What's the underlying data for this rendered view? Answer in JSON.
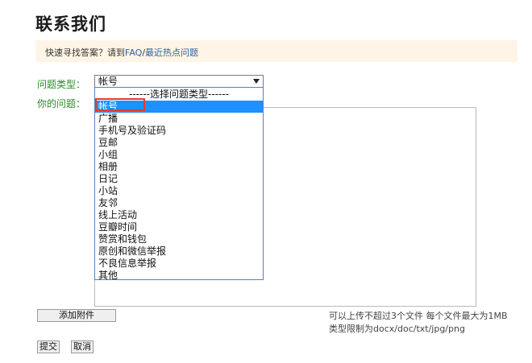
{
  "page": {
    "title": "联系我们"
  },
  "tip": {
    "prefix": "快速寻找答案？请到",
    "link1": "FAQ",
    "separator": "/",
    "link2": "最近热点问题"
  },
  "form": {
    "type_label": "问题类型：",
    "question_label": "你的问题：",
    "select_value": "帐号",
    "options": [
      "------选择问题类型------",
      "帐号",
      "广播",
      "手机号及验证码",
      "豆邮",
      "小组",
      "相册",
      "日记",
      "小站",
      "友邻",
      "线上活动",
      "豆瓣时间",
      "赞赏和钱包",
      "原创和微信举报",
      "不良信息举报",
      "其他"
    ],
    "selected_index": 1,
    "attach_button": "添加附件",
    "attach_note_line1": "可以上传不超过3个文件 每个文件最大为1MB",
    "attach_note_line2": "类型限制为docx/doc/txt/jpg/png",
    "submit_button": "提交",
    "cancel_button": "取消"
  },
  "colors": {
    "label_green": "#2a8a2a",
    "link_blue": "#2f5f9f",
    "tip_bg": "#fff5e6",
    "selected_bg": "#1e90ff",
    "highlight_red": "#e03c31"
  }
}
